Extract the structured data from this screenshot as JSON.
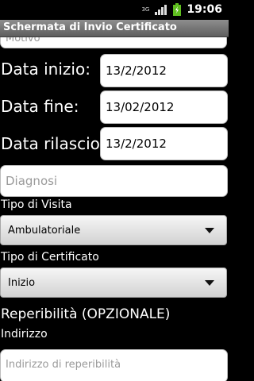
{
  "status_bar": {
    "network": "3G",
    "time": "19:06"
  },
  "title_bar": {
    "title": "Schermata di Invio Certificato"
  },
  "form": {
    "top_partial_hint": "Motivo",
    "start_date": {
      "label": "Data inizio:",
      "value": "13/2/2012"
    },
    "end_date": {
      "label": "Data fine:",
      "value": "13/02/2012"
    },
    "issue_date": {
      "label": "Data rilascio:",
      "value": "13/2/2012"
    },
    "diagnosis": {
      "placeholder": "Diagnosi"
    },
    "visit_type": {
      "label": "Tipo di Visita",
      "selected": "Ambulatoriale"
    },
    "certificate_type": {
      "label": "Tipo di Certificato",
      "selected": "Inizio"
    },
    "availability": {
      "section_title": "Reperibilità (OPZIONALE)",
      "address_label": "Indirizzo",
      "address_placeholder": "Indirizzo di reperibilità"
    }
  },
  "colors": {
    "background": "#000000",
    "titlebar": "#7a7a7a",
    "field_bg": "#ffffff",
    "hint_text": "#9a9a9a",
    "battery": "#5fbe1f"
  }
}
